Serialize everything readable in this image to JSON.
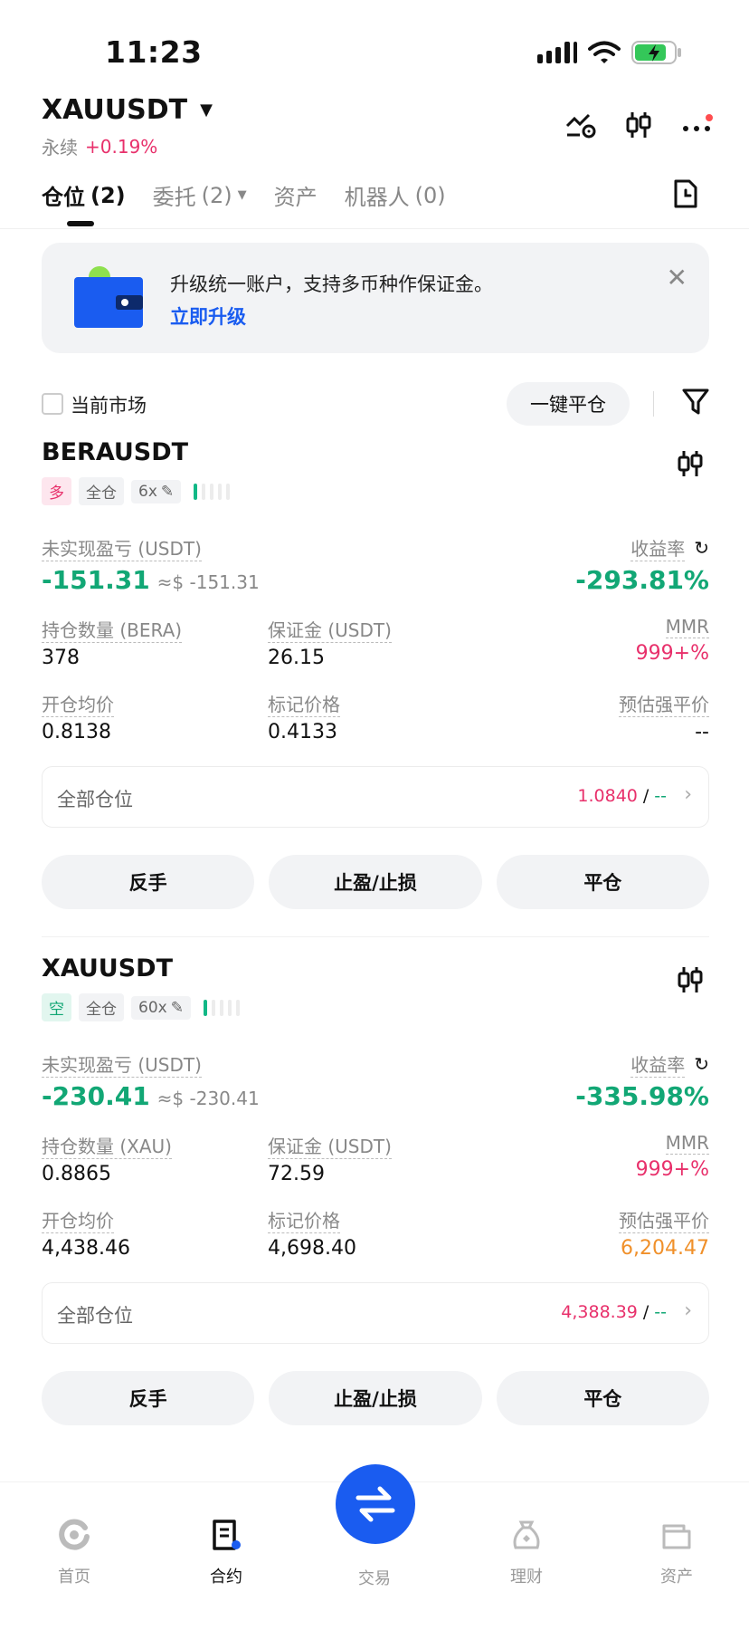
{
  "status_bar": {
    "time": "11:23"
  },
  "header": {
    "symbol": "XAUUSDT",
    "contract_type": "永续",
    "change": "+0.19%"
  },
  "tabs": [
    {
      "label": "仓位",
      "count": "(2)",
      "active": true
    },
    {
      "label": "委托",
      "count": "(2)",
      "active": false
    },
    {
      "label": "资产",
      "count": "",
      "active": false
    },
    {
      "label": "机器人",
      "count": "(0)",
      "active": false
    }
  ],
  "banner": {
    "text": "升级统一账户，支持多币种作保证金。",
    "link": "立即升级"
  },
  "filter": {
    "current_market_label": "当前市场",
    "close_all_label": "一键平仓"
  },
  "positions": [
    {
      "symbol": "BERAUSDT",
      "side_tag": "多",
      "margin_mode": "全仓",
      "leverage": "6x",
      "pnl_label": "未实现盈亏 (USDT)",
      "pnl": "-151.31",
      "pnl_usd": "≈$ -151.31",
      "roe_label": "收益率",
      "roe": "-293.81%",
      "size_label": "持仓数量 (BERA)",
      "size": "378",
      "margin_label": "保证金 (USDT)",
      "margin": "26.15",
      "mmr_label": "MMR",
      "mmr": "999+%",
      "entry_label": "开仓均价",
      "entry": "0.8138",
      "mark_label": "标记价格",
      "mark": "0.4133",
      "liq_label": "预估强平价",
      "liq": "--",
      "all_pos_label": "全部仓位",
      "all_pos_price": "1.0840",
      "all_pos_sep": "/",
      "all_pos_other": "--",
      "actions": [
        "反手",
        "止盈/止损",
        "平仓"
      ]
    },
    {
      "symbol": "XAUUSDT",
      "side_tag": "空",
      "margin_mode": "全仓",
      "leverage": "60x",
      "pnl_label": "未实现盈亏 (USDT)",
      "pnl": "-230.41",
      "pnl_usd": "≈$ -230.41",
      "roe_label": "收益率",
      "roe": "-335.98%",
      "size_label": "持仓数量 (XAU)",
      "size": "0.8865",
      "margin_label": "保证金 (USDT)",
      "margin": "72.59",
      "mmr_label": "MMR",
      "mmr": "999+%",
      "entry_label": "开仓均价",
      "entry": "4,438.46",
      "mark_label": "标记价格",
      "mark": "4,698.40",
      "liq_label": "预估强平价",
      "liq": "6,204.47",
      "all_pos_label": "全部仓位",
      "all_pos_price": "4,388.39",
      "all_pos_sep": "/",
      "all_pos_other": "--",
      "actions": [
        "反手",
        "止盈/止损",
        "平仓"
      ]
    }
  ],
  "bottom_nav": {
    "home": "首页",
    "contract": "合约",
    "trade": "交易",
    "finance": "理财",
    "assets": "资产"
  },
  "colors": {
    "accent": "#1a5cf0",
    "loss_green": "#12a775",
    "pink": "#e8306b",
    "orange": "#f0902a"
  }
}
